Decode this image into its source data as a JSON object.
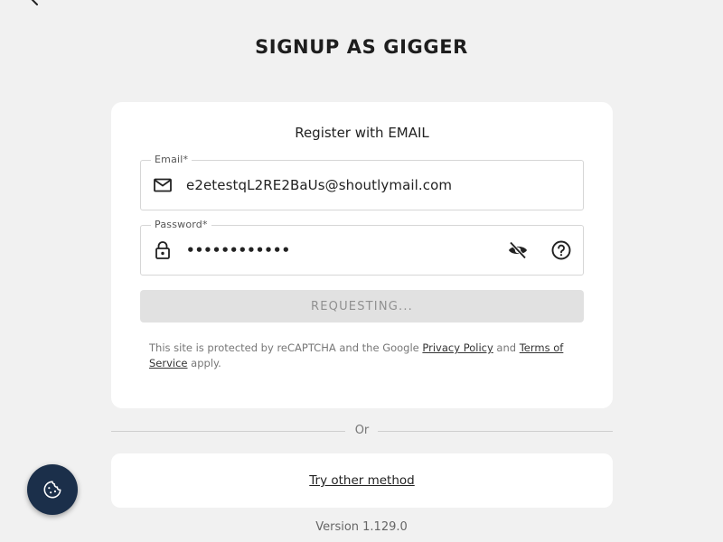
{
  "page": {
    "title": "SIGNUP AS GIGGER"
  },
  "form": {
    "heading": "Register with EMAIL",
    "email": {
      "label": "Email*",
      "value": "e2etestqL2RE2BaUs@shoutlymail.com",
      "icon": "mail-icon"
    },
    "password": {
      "label": "Password*",
      "value": "••••••••••••",
      "icon": "lock-icon",
      "visibility_icon": "eye-off-icon",
      "help_icon": "help-circle-icon"
    },
    "submit_label": "REQUESTING...",
    "legal": {
      "prefix": "This site is protected by reCAPTCHA and the Google ",
      "privacy_link": "Privacy Policy",
      "middle": " and ",
      "terms_link": "Terms of Service",
      "suffix": " apply."
    }
  },
  "divider_label": "Or",
  "alt_method_link": "Try other method",
  "version": "Version 1.129.0",
  "colors": {
    "background": "#f1f1f1",
    "card": "#ffffff",
    "cookie_button": "#1b2f4a",
    "disabled_button": "#e1e1e1"
  },
  "icons": {
    "back": "back-arrow-icon",
    "cookie": "cookie-icon"
  }
}
